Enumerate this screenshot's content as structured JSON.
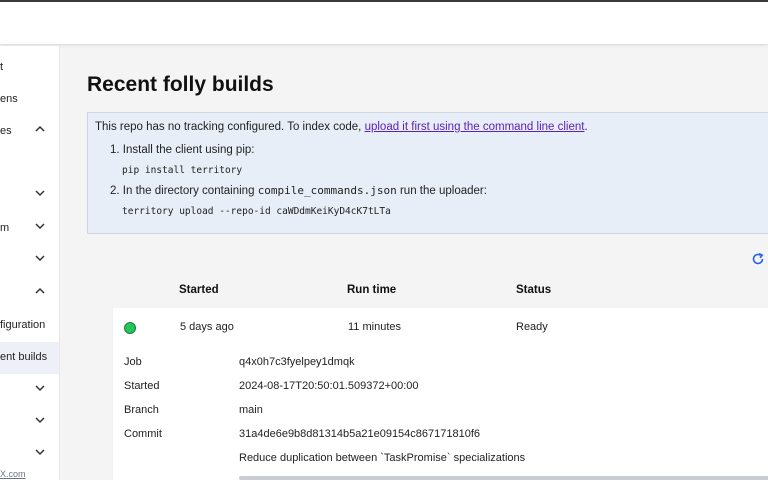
{
  "sidebar": {
    "items": [
      {
        "label": "t",
        "chevron": false,
        "active": false
      },
      {
        "label": "ens",
        "chevron": false,
        "active": false
      },
      {
        "label": "es",
        "chevron": "up",
        "active": false
      },
      {
        "label": "",
        "chevron": false,
        "active": false
      },
      {
        "label": "",
        "chevron": "down",
        "active": false
      },
      {
        "label": "m",
        "chevron": "down",
        "active": false
      },
      {
        "label": "",
        "chevron": "down",
        "active": false
      },
      {
        "label": "",
        "chevron": "up",
        "active": false
      },
      {
        "label": "figuration",
        "chevron": false,
        "active": false
      },
      {
        "label": "ent builds",
        "chevron": false,
        "active": true
      },
      {
        "label": "",
        "chevron": "down",
        "active": false
      },
      {
        "label": "",
        "chevron": "down",
        "active": false
      },
      {
        "label": "",
        "chevron": "down",
        "active": false
      }
    ],
    "footer_prefix": "",
    "footer_link": "X.com"
  },
  "page": {
    "title": "Recent folly builds"
  },
  "notice": {
    "text": "This repo has no tracking configured. To index code,",
    "link": "upload it first using the command line client",
    "text_end": ".",
    "step1": "1. Install the client using pip:",
    "step1_code": "pip install territory",
    "step2_prefix": "2. In the directory containing",
    "step2_file": "compile_commands.json",
    "step2_suffix": "run the uploader:",
    "step2_code": "territory upload --repo-id caWDdmKeiKyD4cK7tLTa"
  },
  "table": {
    "headers": {
      "started": "Started",
      "run_time": "Run time",
      "status": "Status"
    },
    "row": {
      "started": "5 days ago",
      "run_time": "11 minutes",
      "status": "Ready",
      "status_color": "#22c55e"
    },
    "details": {
      "job_label": "Job",
      "job": "q4x0h7c3fyelpey1dmqk",
      "started_label": "Started",
      "started": "2024-08-17T20:50:01.509372+00:00",
      "branch_label": "Branch",
      "branch": "main",
      "commit_label": "Commit",
      "commit": "31a4de6e9b8d81314b5a21e09154c867171810f6",
      "commit_msg": "Reduce duplication between `TaskPromise` specializations"
    }
  },
  "colors": {
    "link": "#5b21b6",
    "notice_bg": "#e8eef7",
    "accent": "#2563eb"
  }
}
